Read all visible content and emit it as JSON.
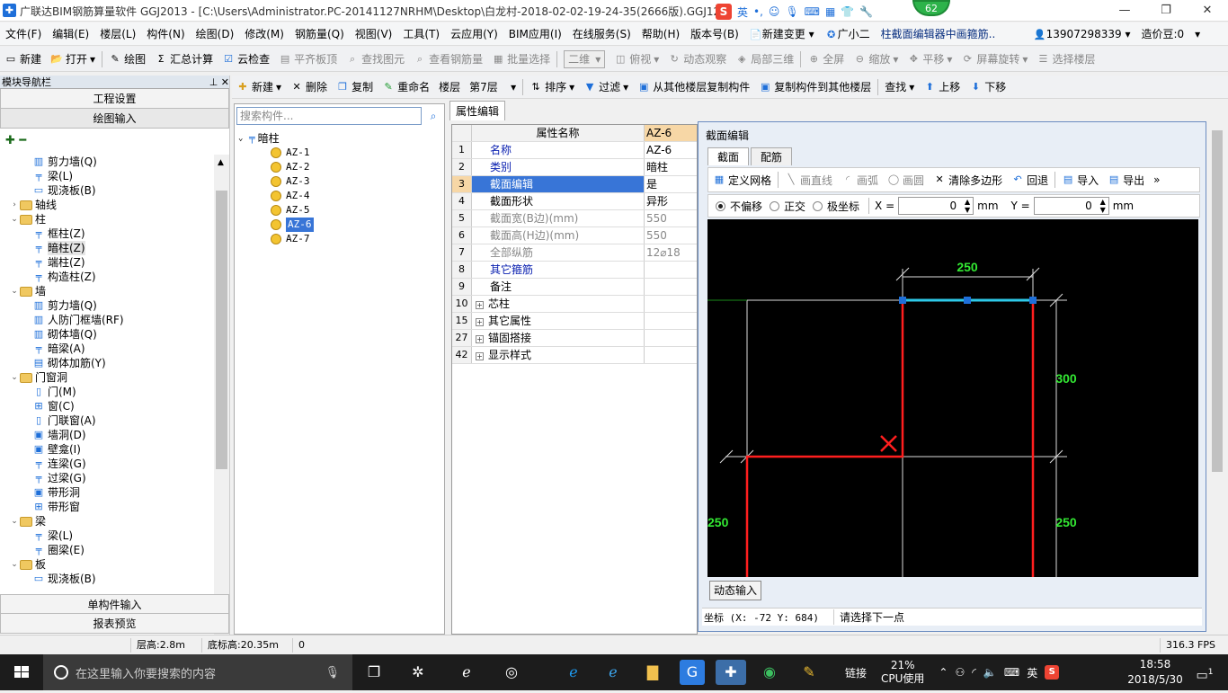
{
  "window": {
    "title": "广联达BIM钢筋算量软件 GGJ2013 - [C:\\Users\\Administrator.PC-20141127NRHM\\Desktop\\白龙村-2018-02-02-19-24-35(2666版).GGJ12]",
    "ime_label": "英",
    "badge": "62"
  },
  "menu": [
    "文件(F)",
    "编辑(E)",
    "楼层(L)",
    "构件(N)",
    "绘图(D)",
    "修改(M)",
    "钢筋量(Q)",
    "视图(V)",
    "工具(T)",
    "云应用(Y)",
    "BIM应用(I)",
    "在线服务(S)",
    "帮助(H)",
    "版本号(B)",
    "新建变更",
    "广小二",
    "柱截面编辑器中画箍筋..",
    "13907298339",
    "造价豆:0"
  ],
  "toolbar1": [
    "新建",
    "打开",
    "绘图",
    "汇总计算",
    "云检查",
    "平齐板顶",
    "查找图元",
    "查看钢筋量",
    "批量选择",
    "二维",
    "俯视",
    "动态观察",
    "局部三维",
    "全屏",
    "缩放",
    "平移",
    "屏幕旋转",
    "选择楼层"
  ],
  "toolbar2": [
    "新建",
    "删除",
    "复制",
    "重命名",
    "楼层",
    "第7层",
    "排序",
    "过滤",
    "从其他楼层复制构件",
    "复制构件到其他楼层",
    "查找",
    "上移",
    "下移"
  ],
  "left_panel": {
    "title": "模块导航栏",
    "top_buttons": [
      "工程设置",
      "绘图输入"
    ],
    "bottom_buttons": [
      "单构件输入",
      "报表预览"
    ],
    "tree": [
      {
        "label": "剪力墙(Q)",
        "level": 2,
        "icon": "wall-icon"
      },
      {
        "label": "梁(L)",
        "level": 2,
        "icon": "beam-icon"
      },
      {
        "label": "现浇板(B)",
        "level": 2,
        "icon": "slab-icon"
      },
      {
        "label": "轴线",
        "level": 0,
        "icon": "folder-icon",
        "exp": "›"
      },
      {
        "label": "柱",
        "level": 0,
        "icon": "folder-icon",
        "exp": "⌄"
      },
      {
        "label": "框柱(Z)",
        "level": 2,
        "icon": "column-icon"
      },
      {
        "label": "暗柱(Z)",
        "level": 2,
        "icon": "column-icon",
        "sel": true
      },
      {
        "label": "端柱(Z)",
        "level": 2,
        "icon": "column-icon"
      },
      {
        "label": "构造柱(Z)",
        "level": 2,
        "icon": "column-icon"
      },
      {
        "label": "墙",
        "level": 0,
        "icon": "folder-icon",
        "exp": "⌄"
      },
      {
        "label": "剪力墙(Q)",
        "level": 2,
        "icon": "wall-icon"
      },
      {
        "label": "人防门框墙(RF)",
        "level": 2,
        "icon": "wall-icon"
      },
      {
        "label": "砌体墙(Q)",
        "level": 2,
        "icon": "wall-icon"
      },
      {
        "label": "暗梁(A)",
        "level": 2,
        "icon": "beam-icon"
      },
      {
        "label": "砌体加筋(Y)",
        "level": 2,
        "icon": "rebar-icon"
      },
      {
        "label": "门窗洞",
        "level": 0,
        "icon": "folder-icon",
        "exp": "⌄"
      },
      {
        "label": "门(M)",
        "level": 2,
        "icon": "door-icon"
      },
      {
        "label": "窗(C)",
        "level": 2,
        "icon": "window-icon"
      },
      {
        "label": "门联窗(A)",
        "level": 2,
        "icon": "door-icon"
      },
      {
        "label": "墙洞(D)",
        "level": 2,
        "icon": "hole-icon"
      },
      {
        "label": "壁龛(I)",
        "level": 2,
        "icon": "hole-icon"
      },
      {
        "label": "连梁(G)",
        "level": 2,
        "icon": "beam-icon"
      },
      {
        "label": "过梁(G)",
        "level": 2,
        "icon": "beam-icon"
      },
      {
        "label": "带形洞",
        "level": 2,
        "icon": "hole-icon"
      },
      {
        "label": "带形窗",
        "level": 2,
        "icon": "window-icon"
      },
      {
        "label": "梁",
        "level": 0,
        "icon": "folder-icon",
        "exp": "⌄"
      },
      {
        "label": "梁(L)",
        "level": 2,
        "icon": "beam-icon"
      },
      {
        "label": "圈梁(E)",
        "level": 2,
        "icon": "beam-icon"
      },
      {
        "label": "板",
        "level": 0,
        "icon": "folder-icon",
        "exp": "⌄"
      },
      {
        "label": "现浇板(B)",
        "level": 2,
        "icon": "slab-icon"
      }
    ]
  },
  "component_panel": {
    "search_placeholder": "搜索构件...",
    "root": "暗柱",
    "items": [
      "AZ-1",
      "AZ-2",
      "AZ-3",
      "AZ-4",
      "AZ-5",
      "AZ-6",
      "AZ-7"
    ],
    "selected_index": 5
  },
  "properties": {
    "tab": "属性编辑",
    "header_name": "属性名称",
    "header_value": "AZ-6",
    "rows": [
      {
        "num": "1",
        "name": "名称",
        "value": "AZ-6",
        "style": "blue"
      },
      {
        "num": "2",
        "name": "类别",
        "value": "暗柱",
        "style": "blue"
      },
      {
        "num": "3",
        "name": "截面编辑",
        "value": "是",
        "style": "sel"
      },
      {
        "num": "4",
        "name": "截面形状",
        "value": "异形",
        "style": ""
      },
      {
        "num": "5",
        "name": "截面宽(B边)(mm)",
        "value": "550",
        "style": "gray"
      },
      {
        "num": "6",
        "name": "截面高(H边)(mm)",
        "value": "550",
        "style": "gray"
      },
      {
        "num": "7",
        "name": "全部纵筋",
        "value": "12⌀18",
        "style": "gray"
      },
      {
        "num": "8",
        "name": "其它箍筋",
        "value": "",
        "style": "blue"
      },
      {
        "num": "9",
        "name": "备注",
        "value": "",
        "style": ""
      },
      {
        "num": "10",
        "name": "芯柱",
        "value": "",
        "style": "grp"
      },
      {
        "num": "15",
        "name": "其它属性",
        "value": "",
        "style": "grp"
      },
      {
        "num": "27",
        "name": "锚固搭接",
        "value": "",
        "style": "grp"
      },
      {
        "num": "42",
        "name": "显示样式",
        "value": "",
        "style": "grp"
      }
    ]
  },
  "section_editor": {
    "title": "截面编辑",
    "tabs": [
      "截面",
      "配筋"
    ],
    "tools": [
      "定义网格",
      "画直线",
      "画弧",
      "画圆",
      "清除多边形",
      "回退",
      "导入",
      "导出"
    ],
    "modes": [
      "不偏移",
      "正交",
      "极坐标"
    ],
    "x_label": "X =",
    "x_value": "0",
    "y_label": "Y =",
    "y_value": "0",
    "unit": "mm",
    "dims": {
      "top": "250",
      "right_upper": "300",
      "right_lower": "250",
      "left": "250"
    },
    "dynamic_input": "动态输入",
    "coord_text": "坐标 (X: -72 Y: 684)",
    "prompt": "请选择下一点"
  },
  "status": {
    "floor_height": "层高:2.8m",
    "base_height": "底标高:20.35m",
    "num": "0",
    "fps": "316.3 FPS"
  },
  "taskbar": {
    "search_placeholder": "在这里输入你要搜索的内容",
    "link": "链接",
    "cpu_percent": "21%",
    "cpu_label": "CPU使用",
    "ime": "英",
    "time": "18:58",
    "date": "2018/5/30",
    "notif": "1"
  }
}
